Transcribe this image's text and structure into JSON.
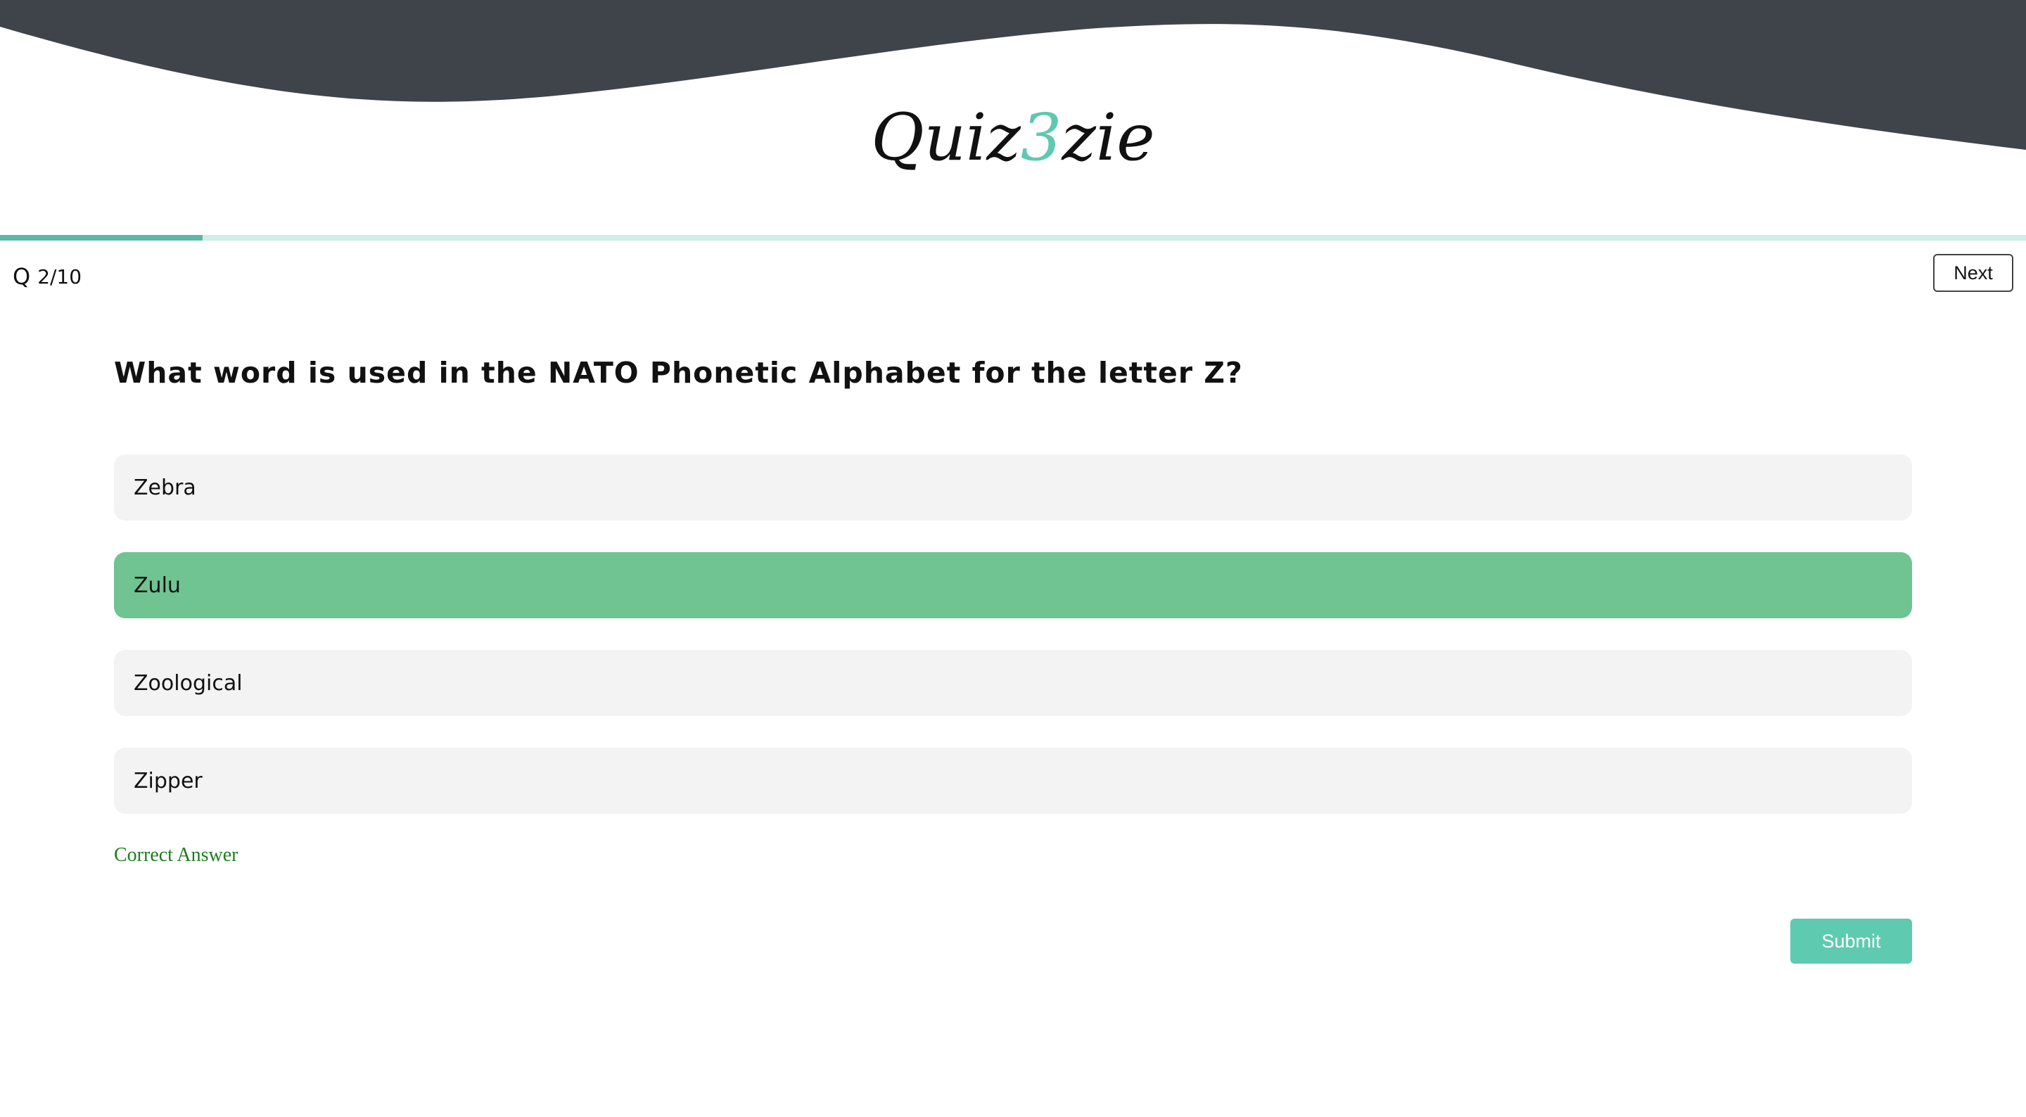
{
  "app": {
    "logo_part1": "Quiz",
    "logo_accent": "3",
    "logo_part2": "zie",
    "accent_color": "#5ec8b0",
    "header_color": "#3f444b"
  },
  "progress": {
    "icon": "question-icon",
    "icon_glyph": "Q",
    "label": "2/10",
    "fraction": 0.1
  },
  "nav": {
    "next_label": "Next"
  },
  "question": {
    "text": "What word is used in the NATO Phonetic Alphabet for the letter Z?"
  },
  "options": [
    {
      "label": "Zebra",
      "selected": false
    },
    {
      "label": "Zulu",
      "selected": true
    },
    {
      "label": "Zoological",
      "selected": false
    },
    {
      "label": "Zipper",
      "selected": false
    }
  ],
  "feedback": {
    "text": "Correct Answer",
    "color": "#1e7d1e"
  },
  "actions": {
    "submit_label": "Submit"
  }
}
